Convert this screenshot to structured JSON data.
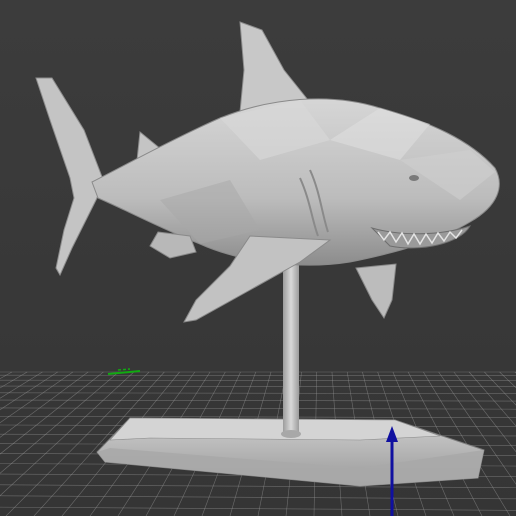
{
  "viewport": {
    "background": "#3a3a3a",
    "grid_color": "#9a9a9a",
    "model_color": "#bdbdbd",
    "axis_colors": {
      "x": "#d22",
      "y": "#1a1",
      "z": "#1010a0"
    }
  },
  "model": {
    "name": "shark-on-stand"
  },
  "axes": {
    "visible": [
      "y",
      "z"
    ]
  },
  "icons": [
    "z-axis-arrow-icon",
    "y-axis-marker-icon"
  ]
}
